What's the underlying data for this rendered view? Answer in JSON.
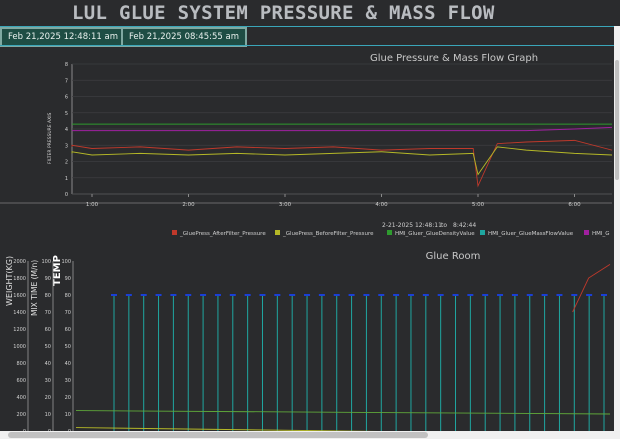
{
  "header": {
    "title": "LUL GLUE SYSTEM PRESSURE & MASS FLOW",
    "start_date": "Feb 21,2025 12:48:11 am",
    "end_date": "Feb 21,2025 08:45:55 am"
  },
  "colors": {
    "accent": "#3aa6b9",
    "button_bg": "#1e4d44",
    "after_filter": "#c0392b",
    "before_filter": "#b5b827",
    "density": "#2e9b2e",
    "mass_flow": "#1fa6a0",
    "purple": "#a020a0"
  },
  "chart_data": [
    {
      "type": "line",
      "title": "Glue Pressure & Mass Flow Graph",
      "ylabel": "FILTER PRESSURE AXIS",
      "ylim": [
        0,
        8
      ],
      "y_ticks": [
        "0",
        "1",
        "2",
        "3",
        "4",
        "5",
        "6",
        "7",
        "8"
      ],
      "x_ticks": [
        "1:00",
        "2:00",
        "3:00",
        "4:00",
        "5:00",
        "6:00"
      ],
      "range_text": {
        "from": "2-21-2025   12:48:11",
        "to_label": "to",
        "to": "8:42:44"
      },
      "legend": [
        {
          "name": "_GluePress_AfterFilter_Pressure",
          "color": "#c0392b"
        },
        {
          "name": "_GluePress_BeforeFilter_Pressure",
          "color": "#b5b827"
        },
        {
          "name": "HMI_Gluer_GlueDensityValue",
          "color": "#2e9b2e"
        },
        {
          "name": "HMI_Gluer_GlueMassFlowValue",
          "color": "#1fa6a0"
        },
        {
          "name": "HMI_G",
          "color": "#a020a0"
        }
      ],
      "legend_position": "bottom",
      "series": [
        {
          "name": "_GluePress_AfterFilter_Pressure",
          "x": [
            0.0,
            0.5,
            1.0,
            1.5,
            2.0,
            2.5,
            3.0,
            3.5,
            4.0,
            4.5,
            4.95,
            5.0,
            5.2,
            5.5,
            6.0,
            6.4
          ],
          "values": [
            2.9,
            3.0,
            2.8,
            2.9,
            2.7,
            2.9,
            2.8,
            2.9,
            2.7,
            2.8,
            2.8,
            0.5,
            3.1,
            3.2,
            3.3,
            2.7
          ]
        },
        {
          "name": "_GluePress_BeforeFilter_Pressure",
          "x": [
            0.0,
            0.5,
            1.0,
            1.5,
            2.0,
            2.5,
            3.0,
            3.5,
            4.0,
            4.5,
            4.95,
            5.0,
            5.2,
            5.5,
            6.0,
            6.4
          ],
          "values": [
            2.5,
            2.6,
            2.4,
            2.5,
            2.4,
            2.5,
            2.4,
            2.5,
            2.6,
            2.4,
            2.5,
            1.2,
            2.9,
            2.7,
            2.5,
            2.4
          ]
        },
        {
          "name": "HMI_Gluer_GlueDensityValue",
          "x": [
            0.0,
            6.4
          ],
          "values": [
            4.3,
            4.3
          ]
        },
        {
          "name": "HMI_G",
          "x": [
            0.0,
            5.5,
            6.0,
            6.4
          ],
          "values": [
            3.9,
            3.9,
            4.0,
            4.1
          ]
        }
      ]
    },
    {
      "type": "line",
      "title": "Glue Room",
      "axes": [
        {
          "label": "WEIGHT(KG)",
          "ticks": [
            "0",
            "200",
            "400",
            "600",
            "800",
            "1000",
            "1200",
            "1400",
            "1600",
            "1800",
            "2000"
          ]
        },
        {
          "label": "MIX TIME (M/n)",
          "ticks": [
            "0",
            "10",
            "20",
            "30",
            "40",
            "50",
            "60",
            "70",
            "80",
            "90",
            "100"
          ]
        },
        {
          "label": "TEMP",
          "ticks": [
            "0",
            "10",
            "20",
            "30",
            "40",
            "50",
            "60",
            "70",
            "80",
            "90",
            "100"
          ]
        }
      ],
      "pulse_level": 80,
      "pulse_count": 34,
      "series": [
        {
          "name": "mass_flow_pulses",
          "axis": "TEMP",
          "values_high": 80,
          "values_low": 0
        },
        {
          "name": "green_line",
          "axis": "WEIGHT(KG)",
          "x": [
            0,
            1
          ],
          "values": [
            240,
            200
          ]
        },
        {
          "name": "yellow_line",
          "axis": "WEIGHT(KG)",
          "x": [
            0,
            1
          ],
          "values": [
            40,
            -40
          ]
        },
        {
          "name": "red_line",
          "axis": "TEMP",
          "x": [
            0.93,
            0.96,
            1.0
          ],
          "values": [
            70,
            90,
            98
          ]
        }
      ]
    }
  ]
}
